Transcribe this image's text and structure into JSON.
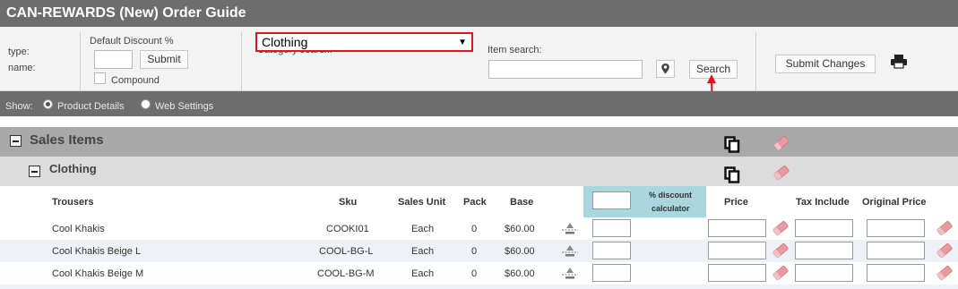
{
  "app": {
    "title": "CAN-REWARDS (New) Order Guide"
  },
  "controls": {
    "type_label": "type:",
    "name_label": "name:",
    "default_discount_label": "Default Discount %",
    "discount_value": "",
    "submit_label": "Submit",
    "compound_label": "Compound",
    "category_search_label": "Category search:",
    "category_value": "Clothing",
    "item_search_label": "Item search:",
    "item_search_value": "",
    "search_label": "Search",
    "submit_changes_label": "Submit Changes"
  },
  "show": {
    "label": "Show:",
    "options": [
      {
        "label": "Product Details",
        "selected": true
      },
      {
        "label": "Web Settings",
        "selected": false
      }
    ]
  },
  "sections": {
    "sales_items": "Sales Items",
    "category": "Clothing"
  },
  "table": {
    "headers": {
      "name": "Trousers",
      "sku": "Sku",
      "unit": "Sales Unit",
      "pack": "Pack",
      "base": "Base",
      "calc_line1": "% discount",
      "calc_line2": "calculator",
      "price": "Price",
      "tax": "Tax Include",
      "original": "Original Price"
    },
    "rows": [
      {
        "name": "Cool Khakis",
        "sku": "COOKI01",
        "unit": "Each",
        "pack": "0",
        "base": "$60.00"
      },
      {
        "name": "Cool Khakis Beige L",
        "sku": "COOL-BG-L",
        "unit": "Each",
        "pack": "0",
        "base": "$60.00"
      },
      {
        "name": "Cool Khakis Beige M",
        "sku": "COOL-BG-M",
        "unit": "Each",
        "pack": "0",
        "base": "$60.00"
      }
    ]
  },
  "colors": {
    "header_bar": "#6d6d6d",
    "highlight_border": "#e1141f",
    "annotation_arrow": "#e1141f",
    "calculator_bg": "#a9d6df",
    "eraser": "#e89aa0"
  },
  "icons": [
    "minus-square-icon",
    "copy-icon",
    "eraser-icon",
    "printer-icon",
    "map-pin-icon",
    "price-tiers-icon",
    "dropdown-arrow-icon"
  ]
}
